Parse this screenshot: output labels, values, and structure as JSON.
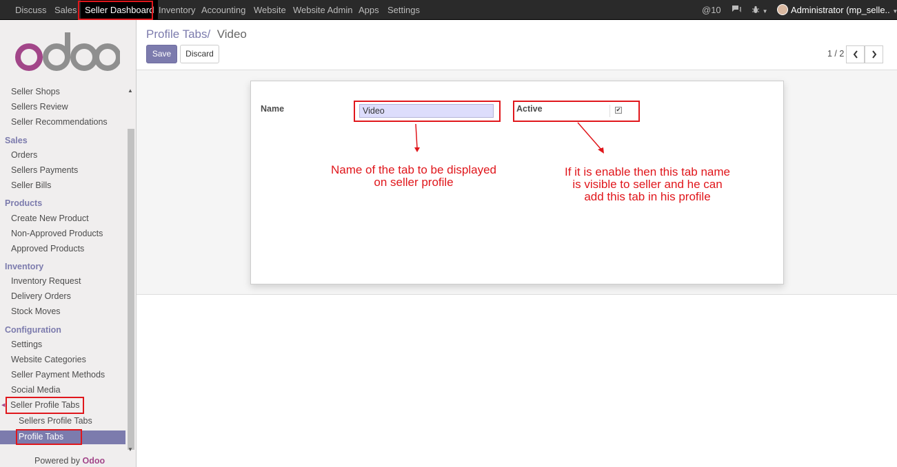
{
  "navbar": {
    "apps": [
      "Discuss",
      "Sales",
      "Seller Dashboard",
      "Inventory",
      "Accounting",
      "Website",
      "Website Admin",
      "Apps",
      "Settings"
    ],
    "notifications": "@10",
    "user": "Administrator (mp_selle.."
  },
  "sidebar": {
    "items_top": [
      "Seller Shops",
      "Sellers Review",
      "Seller Recommendations"
    ],
    "sales_header": "Sales",
    "sales_items": [
      "Orders",
      "Sellers Payments",
      "Seller Bills"
    ],
    "products_header": "Products",
    "products_items": [
      "Create New Product",
      "Non-Approved Products",
      "Approved Products"
    ],
    "inventory_header": "Inventory",
    "inventory_items": [
      "Inventory Request",
      "Delivery Orders",
      "Stock Moves"
    ],
    "config_header": "Configuration",
    "config_items": [
      "Settings",
      "Website Categories",
      "Seller Payment Methods",
      "Social Media",
      "Seller Profile Tabs"
    ],
    "sub_items": [
      "Sellers Profile Tabs",
      "Profile Tabs"
    ],
    "powered_prefix": "Powered by",
    "powered_brand": "Odoo"
  },
  "breadcrumb": {
    "parent": "Profile Tabs",
    "separator": "/",
    "current": "Video"
  },
  "buttons": {
    "save": "Save",
    "discard": "Discard"
  },
  "pager": {
    "value": "1 / 2"
  },
  "form": {
    "name_label": "Name",
    "name_value": "Video",
    "active_label": "Active",
    "active_checked": true
  },
  "annotations": {
    "name_note_line1": "Name of the tab to be displayed",
    "name_note_line2": "on seller profile",
    "active_note_line1": "If it is enable then this tab name",
    "active_note_line2": "is visible to seller and he can",
    "active_note_line3": "add this tab in his profile"
  },
  "colors": {
    "navbar": "#2a2a2a",
    "accent": "#7c7bad",
    "brand": "#a24689",
    "annotation": "#e0161b"
  }
}
